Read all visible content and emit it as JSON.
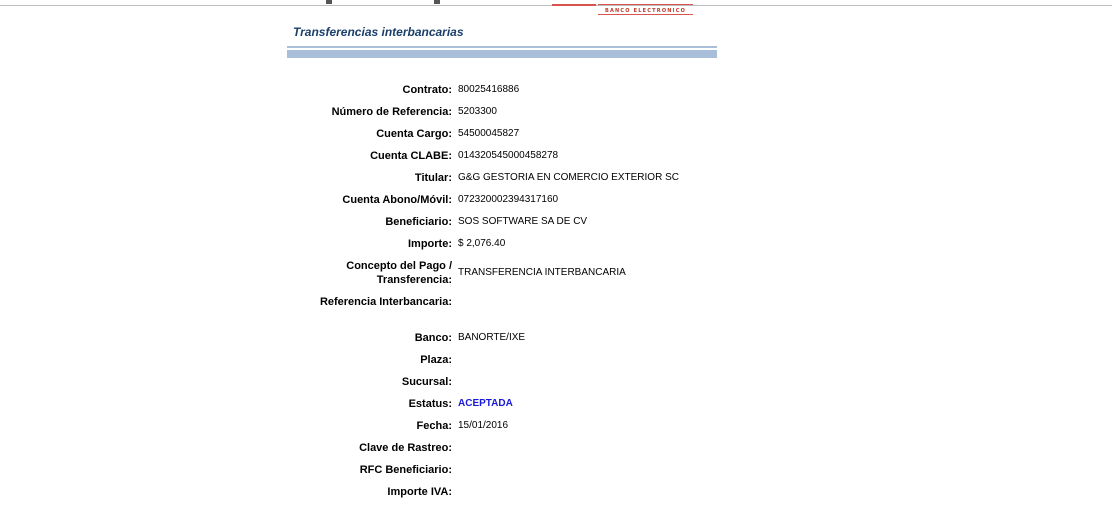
{
  "header": {
    "logo_text": "BANCO ELECTRONICO",
    "section_title": "Transferencias interbancarias"
  },
  "details": [
    {
      "label": "Contrato:",
      "value": "80025416886"
    },
    {
      "label": "Número de Referencia:",
      "value": "5203300"
    },
    {
      "label": "Cuenta Cargo:",
      "value": "54500045827"
    },
    {
      "label": "Cuenta CLABE:",
      "value": "014320545000458278"
    },
    {
      "label": "Titular:",
      "value": "G&G GESTORIA EN COMERCIO EXTERIOR SC"
    },
    {
      "label": "Cuenta Abono/Móvil:",
      "value": "072320002394317160"
    },
    {
      "label": "Beneficiario:",
      "value": "SOS SOFTWARE SA DE CV"
    },
    {
      "label": "Importe:",
      "value": "$ 2,076.40"
    },
    {
      "label": "Concepto del Pago / Transferencia:",
      "value": "TRANSFERENCIA INTERBANCARIA"
    },
    {
      "label": "Referencia Interbancaria:",
      "value": ""
    },
    {
      "label": "Banco:",
      "value": "BANORTE/IXE"
    },
    {
      "label": "Plaza:",
      "value": ""
    },
    {
      "label": "Sucursal:",
      "value": ""
    },
    {
      "label": "Estatus:",
      "value": "ACEPTADA"
    },
    {
      "label": "Fecha:",
      "value": "15/01/2016"
    },
    {
      "label": "Clave de Rastreo:",
      "value": ""
    },
    {
      "label": "RFC Beneficiario:",
      "value": ""
    },
    {
      "label": "Importe IVA:",
      "value": ""
    }
  ],
  "colors": {
    "title": "#1b3f6b",
    "rule": "#a9bfd9",
    "status_accepted": "#1a1ad6",
    "logo": "#c0392b"
  }
}
